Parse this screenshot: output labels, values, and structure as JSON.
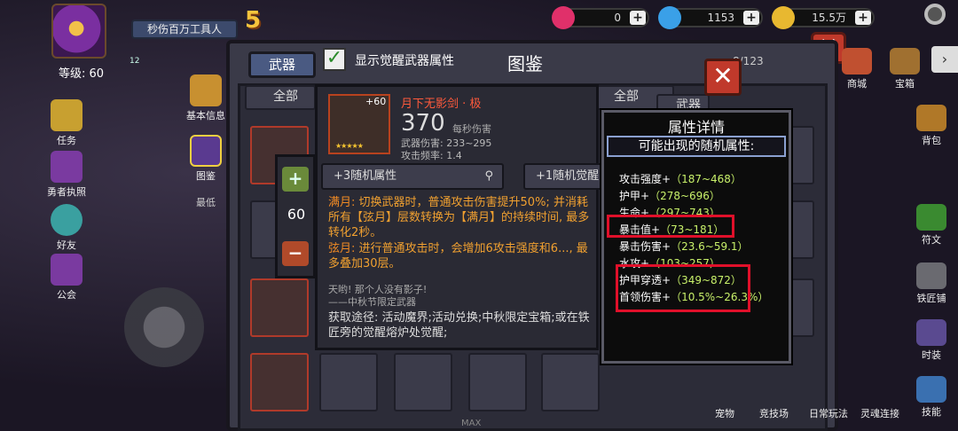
{
  "hud": {
    "level": "等级: 60",
    "player_name": "秒伤百万工具人",
    "vip": "5",
    "badge_count": "12",
    "hearts": "0",
    "gems": "1153",
    "coins": "15.5万"
  },
  "left_menu": {
    "tasks": "任务",
    "hero_license": "勇者执照",
    "friends": "好友",
    "guild": "公会",
    "basic_info": "基本信息",
    "codex": "图鉴",
    "sub_hint": "最低"
  },
  "right_menu": [
    "商城",
    "宝箱",
    "背包",
    "符文",
    "铁匠铺",
    "时装",
    "技能"
  ],
  "bottom_nav": [
    "宠物",
    "竞技场",
    "日常玩法",
    "灵魂连接"
  ],
  "panel": {
    "tab_weapon": "武器",
    "title": "图鉴",
    "show_awaken_label": "显示觉醒武器属性",
    "count": "8/123",
    "filter_all_1": "全部",
    "filter_all_2": "全部",
    "filter_all_3": "全部",
    "filter_weapon": "武器"
  },
  "weapon": {
    "level": "+60",
    "name": "月下无影剑 · 极",
    "dps": "370",
    "dps_label": "每秒伤害",
    "damage": "武器伤害: 233~295",
    "attack_rate": "攻击频率: 1.4",
    "random_attr_btn": "+3随机属性",
    "awaken_btn": "+1随机觉醒",
    "quantity": "60",
    "skill1_name": "满月:",
    "skill1_text": "切换武器时，普通攻击伤害提升50%; 并消耗所有【弦月】层数转换为【满月】的持续时间, 最多转化2秒。",
    "skill2_name": "弦月:",
    "skill2_text": "进行普通攻击时，会增加6攻击强度和6..., 最多叠加30层。",
    "quote1": "天哟! 那个人没有影子!",
    "quote2": "——中秋节限定武器",
    "obtain": "获取途径: 活动魔界;活动兑换;中秋限定宝箱;或在铁匠旁的觉醒熔炉处觉醒;"
  },
  "attributes": {
    "title": "属性详情",
    "subtitle": "可能出现的随机属性:",
    "rows": [
      {
        "name": "攻击强度+",
        "range": "（187~468）"
      },
      {
        "name": "护甲+",
        "range": "（278~696）"
      },
      {
        "name": "生命+",
        "range": "（297~743）"
      },
      {
        "name": "暴击值+",
        "range": "（73~181）"
      },
      {
        "name": "暴击伤害+",
        "range": "（23.6~59.1）"
      },
      {
        "name": "水攻+",
        "range": "（103~257）"
      },
      {
        "name": "护甲穿透+",
        "range": "（349~872）"
      },
      {
        "name": "首领伤害+",
        "range": "（10.5%~26.3%）"
      }
    ]
  },
  "bottom_text": "MAX",
  "colors": {
    "accent_red": "#e0102a",
    "value_green": "#c8f06a",
    "weapon_name": "#ff5a3c"
  }
}
